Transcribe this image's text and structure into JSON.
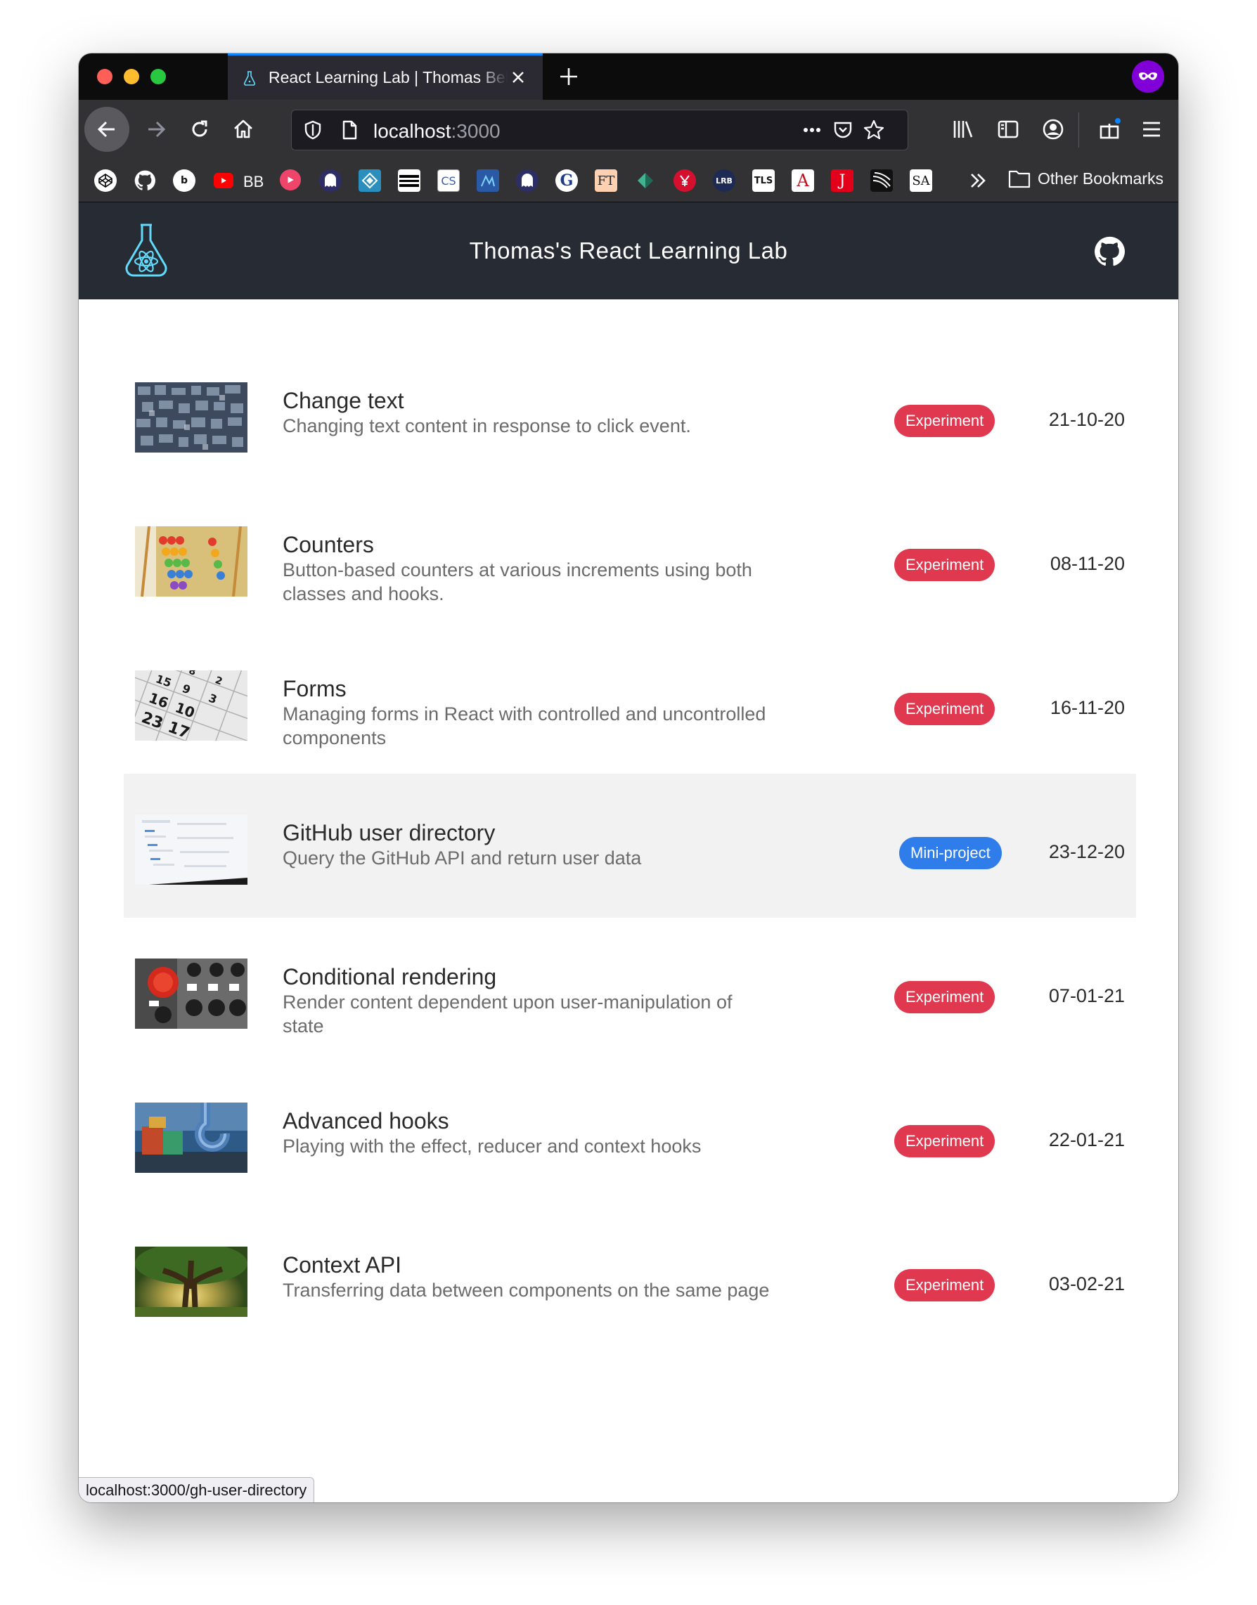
{
  "browser": {
    "tab_title": "React Learning Lab | Thomas Bell",
    "url_host": "localhost",
    "url_port": ":3000",
    "bookmarks": {
      "bb_label": "BB",
      "cs_label": "CS",
      "ft_label": "FT",
      "g_label": "G",
      "lrb_label": "LRB",
      "tls_label": "TLS",
      "a_label": "A",
      "j_label": "J",
      "sa_label": "SA",
      "other_label": "Other Bookmarks"
    },
    "status_url": "localhost:3000/gh-user-directory"
  },
  "app": {
    "title": "Thomas's React Learning Lab"
  },
  "colors": {
    "experiment": "#e0384f",
    "mini_project": "#2f7dea",
    "header_bg": "#272b33"
  },
  "projects": [
    {
      "title": "Change text",
      "description": "Changing text content in response to click event.",
      "badge": "Experiment",
      "date": "21-10-20",
      "thumb": "letterpress-blocks"
    },
    {
      "title": "Counters",
      "description": "Button-based counters at various increments using both classes and hooks.",
      "badge": "Experiment",
      "date": "08-11-20",
      "thumb": "abacus"
    },
    {
      "title": "Forms",
      "description": "Managing forms in React with controlled and uncontrolled components",
      "badge": "Experiment",
      "date": "16-11-20",
      "thumb": "calendar"
    },
    {
      "title": "GitHub user directory",
      "description": "Query the GitHub API and return user data",
      "badge": "Mini-project",
      "date": "23-12-20",
      "thumb": "laptop-screen"
    },
    {
      "title": "Conditional rendering",
      "description": "Render content dependent upon user-manipulation of state",
      "badge": "Experiment",
      "date": "07-01-21",
      "thumb": "control-panel"
    },
    {
      "title": "Advanced hooks",
      "description": "Playing with the effect, reducer and context hooks",
      "badge": "Experiment",
      "date": "22-01-21",
      "thumb": "crane-hook"
    },
    {
      "title": "Context API",
      "description": "Transferring data between components on the same page",
      "badge": "Experiment",
      "date": "03-02-21",
      "thumb": "tree"
    }
  ]
}
